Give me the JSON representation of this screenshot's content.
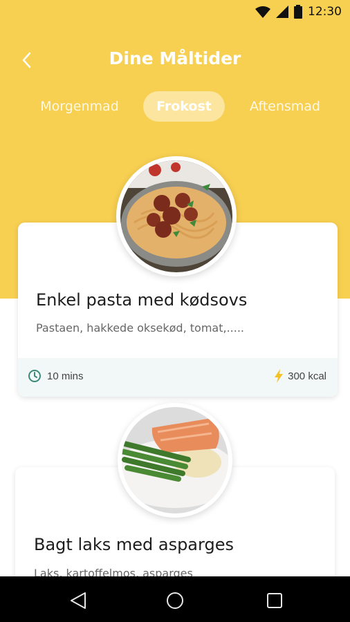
{
  "status_bar": {
    "time": "12:30"
  },
  "header": {
    "title": "Dine Måltider"
  },
  "tabs": [
    {
      "label": "Morgenmad",
      "selected": false
    },
    {
      "label": "Frokost",
      "selected": true
    },
    {
      "label": "Aftensmad",
      "selected": false
    }
  ],
  "meals": [
    {
      "title": "Enkel pasta med kødsovs",
      "description": "Pastaen, hakkede oksekød, tomat,.....",
      "time": "10 mins",
      "kcal": "300 kcal"
    },
    {
      "title": "Bagt laks med asparges",
      "description": "Laks, kartoffelmos, asparges"
    }
  ],
  "colors": {
    "accent": "#f7cf51",
    "time_icon": "#3c8a7a",
    "kcal_icon": "#f5c226"
  }
}
